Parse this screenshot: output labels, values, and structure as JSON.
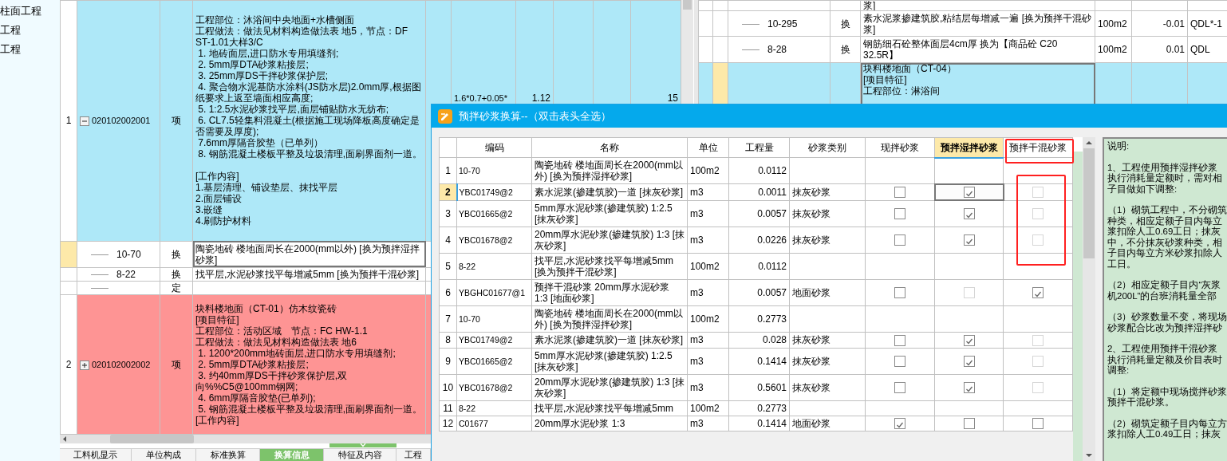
{
  "sidebar": {
    "items": [
      {
        "label": "柱面工程"
      },
      {
        "label": "工程"
      },
      {
        "label": "工程"
      }
    ]
  },
  "main_table": {
    "rows": [
      {
        "number": "1",
        "code": "020102002001",
        "expanded": true,
        "type": "项",
        "color": "#aee8f8",
        "description": [
          [
            "工程部位：沐浴间中央地面+水槽侧面",
            "工程做法：做法见材料构造做法表 地5，节点：DF ST-1.01大样3/C",
            " 1. 地砖面层,进口防水专用填缝剂;",
            " 2. 5mm厚DTA砂浆粘接层;",
            " 3. 25mm厚DS干拌砂浆保护层;",
            " 4. 聚合物水泥基防水涂料(JS防水层)2.0mm厚,根据图纸要求上返至墙面相应高度;",
            " 5. 1:2.5水泥砂浆找平层,面层铺贴防水无纺布;",
            " 6. CL7.5轻集料混凝土(根据施工现场降板高度确定是否需要及厚度);",
            " 7.6mm厚隔音胶垫（已单列）",
            " 8. 钢筋混凝土楼板平整及垃圾清理,面刷界面剂一道。"
          ],
          [
            "[工作内容]",
            "1.基层清理、铺设垫层、抹找平层",
            "2.面层铺设",
            "3.嵌缝",
            "4.刷防护材料"
          ]
        ],
        "column_7": "1.6*0.7+0.05*",
        "column_8": "1.12",
        "column_11": "15",
        "children": [
          {
            "code": "10-70",
            "type": "换",
            "selected": true,
            "description": "陶瓷地砖 楼地面周长在2000(mm以外) [换为预拌湿拌砂浆]"
          },
          {
            "code": "8-22",
            "type": "换",
            "selected": false,
            "description": "找平层,水泥砂浆找平每增减5mm [换为预拌干混砂浆]"
          },
          {
            "type": "定",
            "selected": false
          }
        ]
      },
      {
        "number": "2",
        "code": "020102002002",
        "expanded": false,
        "type": "项",
        "color": "#fe9494",
        "description": [
          [
            "块料楼地面（CT-01）仿木纹瓷砖",
            "[项目特征]",
            "工程部位：活动区域　节点：FC HW-1.1",
            "工程做法：做法见材料构造做法表 地6",
            " 1. 1200*200mm地砖面层,进口防水专用填缝剂;",
            " 2. 5mm厚DTA砂浆粘接层;",
            " 3. 约40mm厚DS干拌砂浆保护层,双向%%C5@100mm钢网;",
            " 4. 6mm厚隔音胶垫(已单列);",
            " 5. 钢筋混凝土楼板平整及垃圾清理,面刷界面剂一道。",
            "[工作内容]"
          ]
        ]
      }
    ]
  },
  "bottom_tabs": [
    {
      "label": "工料机显示",
      "selected": false
    },
    {
      "label": "单位构成",
      "selected": false
    },
    {
      "label": "标准换算",
      "selected": false
    },
    {
      "label": "换算信息",
      "selected": true
    },
    {
      "label": "特征及内容",
      "selected": false
    },
    {
      "label": "工程",
      "selected": false
    }
  ],
  "right_table": {
    "rows": [
      {
        "description": "浆]",
        "selected": false
      },
      {
        "code": "10-295",
        "type": "换",
        "selected": false,
        "description": "素水泥浆掺建筑胶,粘结层每增减一遍 [换为预拌干混砂浆]",
        "unit": "100m2",
        "quantity": "-0.01",
        "expression": "QDL*-1"
      },
      {
        "code": "8-28",
        "type": "换",
        "selected": false,
        "description": "钢筋细石砼整体面层4cm厚 换为【商品砼 C20 32.5R】",
        "unit": "100m2",
        "quantity": "0.01",
        "expression": "QDL"
      },
      {
        "selected": true,
        "color": "#aee8f8",
        "description": "块料楼地面（CT-04）\n[项目特征]\n工程部位：淋浴间"
      }
    ]
  },
  "dialog": {
    "title": "预拌砂浆换算--（双击表头全选）",
    "columns": [
      {
        "label": "编码"
      },
      {
        "label": "名称"
      },
      {
        "label": "单位"
      },
      {
        "label": "工程量"
      },
      {
        "label": "砂浆类别"
      },
      {
        "label": "现拌砂浆",
        "selected": false
      },
      {
        "label": "预拌湿拌砂浆",
        "selected": true
      },
      {
        "label": "预拌干混砂浆",
        "selected": false
      }
    ],
    "rows": [
      {
        "number": "1",
        "selected": false,
        "code": "10-70",
        "name": "陶瓷地砖 楼地面周长在2000(mm以外) [换为预拌湿拌砂浆]",
        "unit": "100m2",
        "quantity": "0.0112"
      },
      {
        "number": "2",
        "selected": true,
        "code": "YBC01749@2",
        "name": "素水泥浆(掺建筑胶)一道 [抹灰砂浆]",
        "unit": "m3",
        "quantity": "0.0011",
        "category": "抹灰砂浆",
        "options": [
          {
            "checked": false,
            "disabled": false,
            "focused": false
          },
          {
            "checked": true,
            "disabled": false,
            "focused": true
          },
          {
            "checked": false,
            "disabled": true,
            "focused": false
          }
        ]
      },
      {
        "number": "3",
        "selected": false,
        "code": "YBC01665@2",
        "name": "5mm厚水泥砂浆(掺建筑胶) 1:2.5 [抹灰砂浆]",
        "unit": "m3",
        "quantity": "0.0057",
        "category": "抹灰砂浆",
        "options": [
          {
            "checked": false,
            "disabled": false,
            "focused": false
          },
          {
            "checked": true,
            "disabled": false,
            "focused": false
          },
          {
            "checked": false,
            "disabled": true,
            "focused": false
          }
        ]
      },
      {
        "number": "4",
        "selected": false,
        "code": "YBC01678@2",
        "name": "20mm厚水泥砂浆(掺建筑胶) 1:3 [抹灰砂浆]",
        "unit": "m3",
        "quantity": "0.0226",
        "category": "抹灰砂浆",
        "options": [
          {
            "checked": false,
            "disabled": false,
            "focused": false
          },
          {
            "checked": true,
            "disabled": false,
            "focused": false
          },
          {
            "checked": false,
            "disabled": true,
            "focused": false
          }
        ]
      },
      {
        "number": "5",
        "selected": false,
        "code": "8-22",
        "name": "找平层,水泥砂浆找平每增减5mm [换为预拌干混砂浆]",
        "unit": "100m2",
        "quantity": "0.0112"
      },
      {
        "number": "6",
        "selected": false,
        "code": "YBGHC01677@1",
        "name": "预拌干混砂浆 20mm厚水泥砂浆 1:3 [地面砂浆]",
        "unit": "m3",
        "quantity": "0.0057",
        "category": "地面砂浆",
        "options": [
          {
            "checked": false,
            "disabled": false,
            "focused": false
          },
          {
            "checked": false,
            "disabled": true,
            "focused": false
          },
          {
            "checked": true,
            "disabled": false,
            "focused": false
          }
        ]
      },
      {
        "number": "7",
        "selected": false,
        "code": "10-70",
        "name": "陶瓷地砖 楼地面周长在2000(mm以外) [换为预拌湿拌砂浆]",
        "unit": "100m2",
        "quantity": "0.2773"
      },
      {
        "number": "8",
        "selected": false,
        "code": "YBC01749@2",
        "name": "素水泥浆(掺建筑胶)一道 [抹灰砂浆]",
        "unit": "m3",
        "quantity": "0.028",
        "category": "抹灰砂浆",
        "options": [
          {
            "checked": false,
            "disabled": false,
            "focused": false
          },
          {
            "checked": true,
            "disabled": false,
            "focused": false
          },
          {
            "checked": false,
            "disabled": true,
            "focused": false
          }
        ]
      },
      {
        "number": "9",
        "selected": false,
        "code": "YBC01665@2",
        "name": "5mm厚水泥砂浆(掺建筑胶) 1:2.5 [抹灰砂浆]",
        "unit": "m3",
        "quantity": "0.1414",
        "category": "抹灰砂浆",
        "options": [
          {
            "checked": false,
            "disabled": false,
            "focused": false
          },
          {
            "checked": true,
            "disabled": false,
            "focused": false
          },
          {
            "checked": false,
            "disabled": true,
            "focused": false
          }
        ]
      },
      {
        "number": "10",
        "selected": false,
        "code": "YBC01678@2",
        "name": "20mm厚水泥砂浆(掺建筑胶) 1:3 [抹灰砂浆]",
        "unit": "m3",
        "quantity": "0.5601",
        "category": "抹灰砂浆",
        "options": [
          {
            "checked": false,
            "disabled": false,
            "focused": false
          },
          {
            "checked": true,
            "disabled": false,
            "focused": false
          },
          {
            "checked": false,
            "disabled": true,
            "focused": false
          }
        ]
      },
      {
        "number": "11",
        "selected": false,
        "code": "8-22",
        "name": "找平层,水泥砂浆找平每增减5mm",
        "unit": "100m2",
        "quantity": "0.2773"
      },
      {
        "number": "12",
        "selected": false,
        "code": "C01677",
        "name": "20mm厚水泥砂浆 1:3",
        "unit": "m3",
        "quantity": "0.1414",
        "category": "地面砂浆",
        "options": [
          {
            "checked": true,
            "disabled": false,
            "focused": false
          },
          {
            "checked": false,
            "disabled": false,
            "focused": false
          },
          {
            "checked": false,
            "disabled": false,
            "focused": false
          }
        ]
      }
    ],
    "explanation": {
      "title": "说明:",
      "paragraphs": [
        [
          " 1、工程使用预拌湿拌砂浆",
          "执行消耗量定额时，需对相",
          "子目做如下调整:"
        ],
        [
          "（1）砌筑工程中，不分砌筑",
          "种类，相应定额子目内每立",
          "浆扣除人工0.69工日；抹灰",
          "中，不分抹灰砂浆种类，相",
          "子目内每立方米砂浆扣除人",
          "工日。"
        ],
        [
          "（2）相应定额子目内“灰浆",
          "机200L”的台班消耗量全部"
        ],
        [
          "（3）砂浆数量不变，将现场",
          "砂浆配合比改为预拌湿拌砂"
        ],
        [
          " 2、工程使用预拌干混砂浆",
          "执行消耗量定额及价目表时",
          "调整:"
        ],
        [
          "（1）将定额中现场搅拌砂浆",
          "预拌干混砂浆。"
        ],
        [
          "（2）砌筑定额子目内每立方",
          "浆扣除人工0.49工日；抹灰"
        ]
      ]
    }
  }
}
